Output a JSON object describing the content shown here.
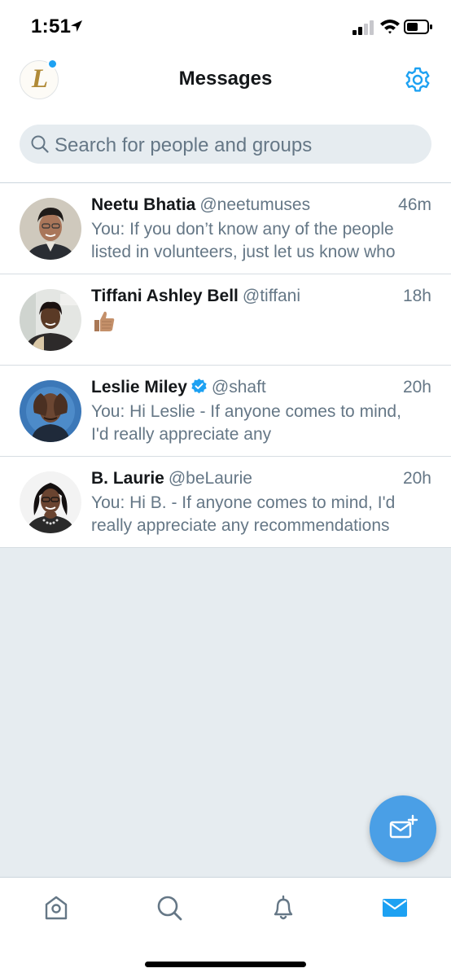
{
  "status_bar": {
    "time": "1:51"
  },
  "header": {
    "avatar_letter": "L",
    "title": "Messages"
  },
  "search": {
    "placeholder": "Search for people and groups"
  },
  "conversations": [
    {
      "name": "Neetu Bhatia",
      "handle": "@neetumuses",
      "time": "46m",
      "verified": false,
      "preview_line1": "You: If you don’t know any of the people",
      "preview_line2": "listed in volunteers, just let us know who"
    },
    {
      "name": "Tiffani Ashley Bell",
      "handle": "@tiffani",
      "time": "18h",
      "verified": false,
      "preview_emoji": "thumbs-up-emoji"
    },
    {
      "name": "Leslie Miley",
      "handle": "@shaft",
      "time": "20h",
      "verified": true,
      "preview_line1": "You: Hi Leslie - If anyone comes to mind,",
      "preview_line2": "I'd really appreciate any"
    },
    {
      "name": "B. Laurie",
      "handle": "@beLaurie",
      "time": "20h",
      "verified": false,
      "preview_line1": "You: Hi B. - If anyone comes to mind, I'd",
      "preview_line2": "really appreciate any recommendations"
    }
  ],
  "tabbar": {
    "items": [
      "home-icon",
      "search-icon",
      "bell-icon",
      "mail-icon"
    ],
    "active": "mail-icon"
  },
  "colors": {
    "accent": "#1da1f2",
    "fab": "#4a9fe6",
    "secondary_text": "#657786",
    "background": "#e6ecf0"
  }
}
